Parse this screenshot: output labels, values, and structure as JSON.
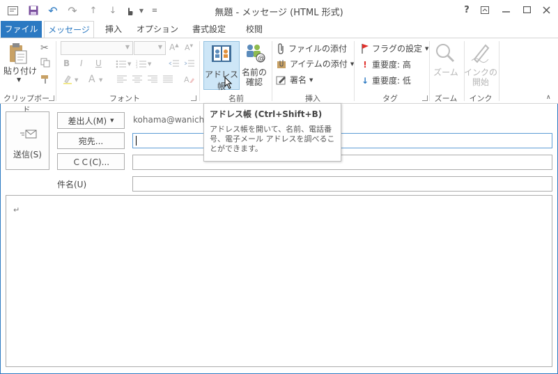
{
  "window": {
    "title": "無題 - メッセージ (HTML 形式)",
    "accent": "#2b79c2"
  },
  "quick_access": [
    "outlook-icon",
    "save-icon",
    "undo-icon",
    "redo-icon",
    "up-arrow-icon",
    "down-arrow-icon",
    "touch-mode-icon",
    "customize-icon"
  ],
  "title_controls": {
    "help": "?"
  },
  "tabs": [
    {
      "label": "ファイル"
    },
    {
      "label": "メッセージ"
    },
    {
      "label": "挿入"
    },
    {
      "label": "オプション"
    },
    {
      "label": "書式設定"
    },
    {
      "label": "校閲"
    }
  ],
  "ribbon": {
    "clipboard": {
      "paste": "貼り付け",
      "group": "クリップボード"
    },
    "font": {
      "bold": "B",
      "italic": "I",
      "underline": "U",
      "group": "フォント"
    },
    "names": {
      "address_book": "アドレス帳",
      "check_names_1": "名前の",
      "check_names_2": "確認",
      "group": "名前"
    },
    "include": {
      "attach_file": "ファイルの添付",
      "attach_item": "アイテムの添付",
      "signature": "署名",
      "group": "挿入"
    },
    "tags": {
      "follow_up": "フラグの設定",
      "high_importance": "重要度: 高",
      "low_importance": "重要度: 低",
      "group": "タグ"
    },
    "zoom": {
      "zoom": "ズーム",
      "group": "ズーム"
    },
    "ink": {
      "ink_1": "インクの",
      "ink_2": "開始",
      "group": "インク"
    }
  },
  "compose": {
    "send": "送信(S)",
    "from_button": "差出人(M)",
    "from_value": "kohama@wanicha",
    "to_button": "宛先...",
    "cc_button": "ＣＣ(C)...",
    "subject_label": "件名(U)",
    "to_value": "",
    "cc_value": "",
    "subject_value": "",
    "body_mark": "↵"
  },
  "tooltip": {
    "title": "アドレス帳 (Ctrl+Shift+B)",
    "description": "アドレス帳を開いて、名前、電話番号、電子メール アドレスを調べることができます。"
  }
}
